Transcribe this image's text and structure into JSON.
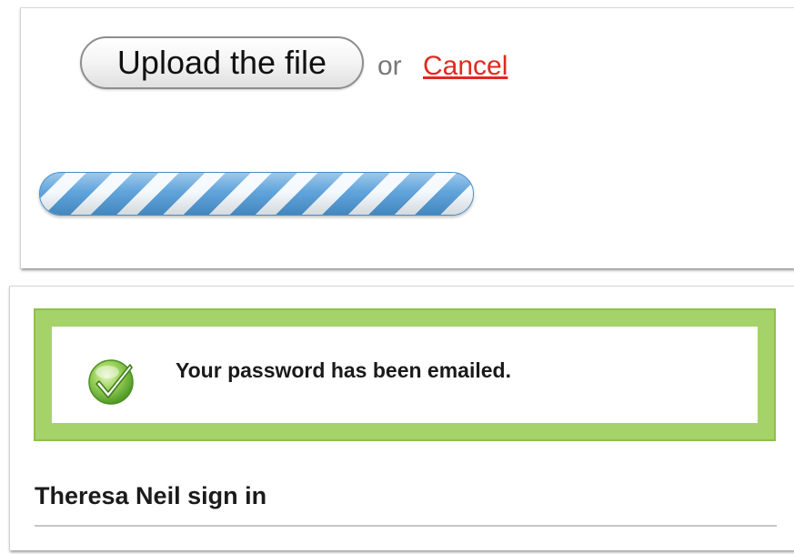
{
  "upload": {
    "button_label": "Upload the file",
    "or_text": "or",
    "cancel_label": "Cancel"
  },
  "progress": {
    "fill_fraction": 1.0,
    "state": "indeterminate",
    "color": "#5aa2dc"
  },
  "alert": {
    "message": "Your password has been emailed.",
    "icon": "check-circle-icon",
    "border_color": "#a6d26a",
    "icon_color": "#6bb83a"
  },
  "signin": {
    "title": "Theresa Neil sign in"
  },
  "colors": {
    "cancel_link": "#e02a1f",
    "muted_text": "#777777"
  }
}
